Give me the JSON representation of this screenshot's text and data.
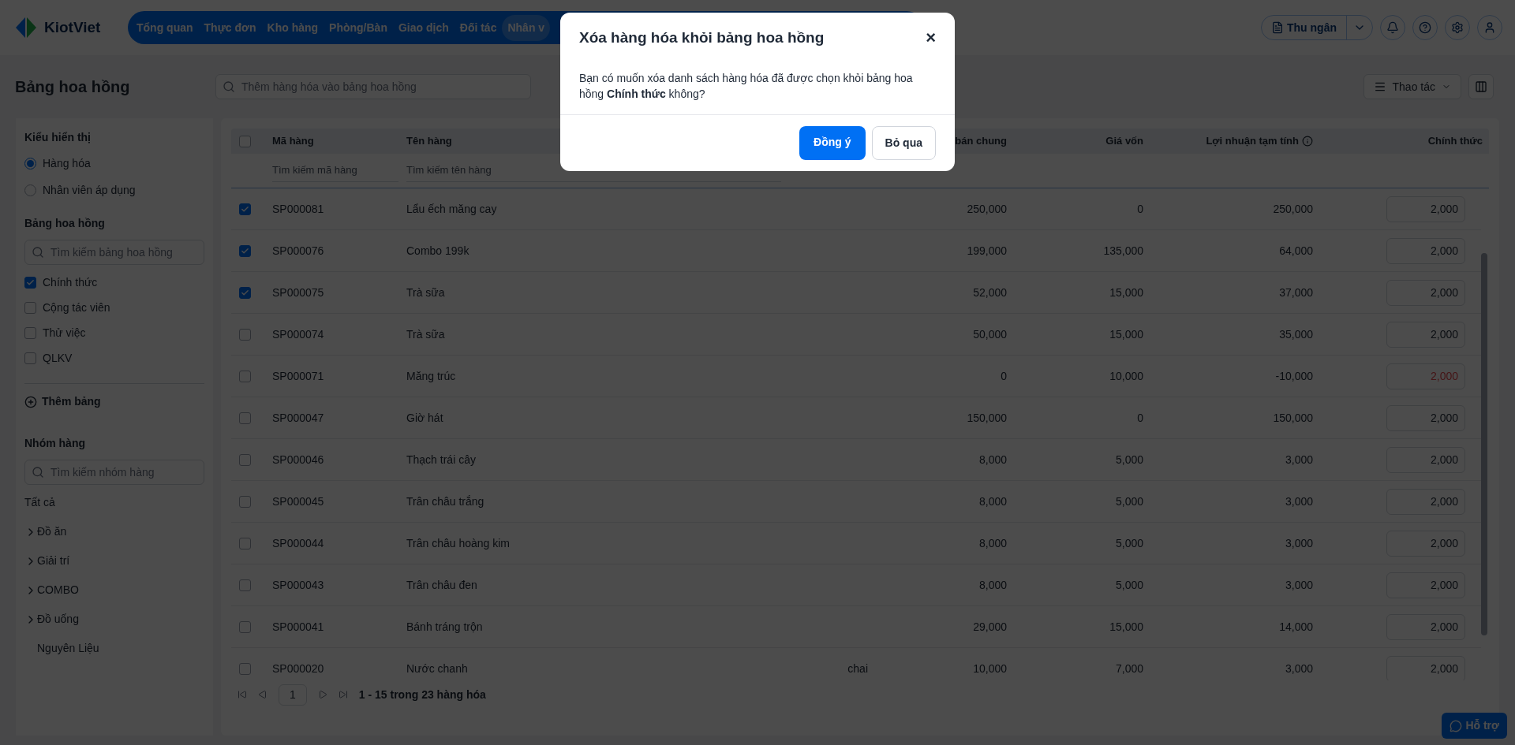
{
  "nav": {
    "logo": "KiotViet",
    "items": [
      {
        "label": "Tổng quan",
        "selected": false
      },
      {
        "label": "Thực đơn",
        "selected": false
      },
      {
        "label": "Kho hàng",
        "selected": false
      },
      {
        "label": "Phòng/Bàn",
        "selected": false
      },
      {
        "label": "Giao dịch",
        "selected": false
      },
      {
        "label": "Đối tác",
        "selected": false
      },
      {
        "label": "Nhân v",
        "selected": true
      }
    ],
    "cashier": "Thu ngân"
  },
  "page": {
    "title": "Bảng hoa hồng",
    "search_placeholder": "Thêm hàng hóa vào bảng hoa hồng",
    "actions": "Thao tác"
  },
  "sidebar": {
    "view_title": "Kiểu hiển thị",
    "views": [
      {
        "label": "Hàng hóa",
        "selected": true
      },
      {
        "label": "Nhân viên áp dụng",
        "selected": false
      }
    ],
    "tables_title": "Bảng hoa hồng",
    "tables_placeholder": "Tìm kiếm bảng hoa hồng",
    "tables": [
      {
        "label": "Chính thức",
        "checked": true
      },
      {
        "label": "Cộng tác viên",
        "checked": false
      },
      {
        "label": "Thử việc",
        "checked": false
      },
      {
        "label": "QLKV",
        "checked": false
      }
    ],
    "add_table": "Thêm bảng",
    "groups_title": "Nhóm hàng",
    "groups_placeholder": "Tìm kiếm nhóm hàng",
    "all": "Tất cả",
    "groups": [
      {
        "label": "Đồ ăn",
        "expandable": true
      },
      {
        "label": "Giải trí",
        "expandable": true
      },
      {
        "label": "COMBO",
        "expandable": true
      },
      {
        "label": "Đồ uống",
        "expandable": true
      },
      {
        "label": "Nguyên Liệu",
        "expandable": false
      }
    ]
  },
  "table": {
    "all_checked": false,
    "columns": [
      "Mã hàng",
      "Tên hàng",
      "bán chung",
      "Giá vốn",
      "Lợi nhuận tạm tính",
      "Chính thức"
    ],
    "filter_placeholders": [
      "Tìm kiếm mã hàng",
      "Tìm kiếm tên hàng"
    ],
    "rows": [
      {
        "code": "SP000081",
        "name": "Lẩu ếch măng cay",
        "price": "250,000",
        "cost": "0",
        "profit": "250,000",
        "commission": "2,000",
        "checked": true,
        "invalid": false
      },
      {
        "code": "SP000076",
        "name": "Combo 199k",
        "price": "199,000",
        "cost": "135,000",
        "profit": "64,000",
        "commission": "2,000",
        "checked": true,
        "invalid": false
      },
      {
        "code": "SP000075",
        "name": "Trà sữa",
        "price": "52,000",
        "cost": "15,000",
        "profit": "37,000",
        "commission": "2,000",
        "checked": true,
        "invalid": false
      },
      {
        "code": "SP000074",
        "name": "Trà sữa",
        "price": "50,000",
        "cost": "15,000",
        "profit": "35,000",
        "commission": "2,000",
        "checked": false,
        "invalid": false
      },
      {
        "code": "SP000071",
        "name": "Măng trúc",
        "price": "0",
        "cost": "10,000",
        "profit": "-10,000",
        "commission": "2,000",
        "checked": false,
        "invalid": true
      },
      {
        "code": "SP000047",
        "name": "Giờ hát",
        "price": "150,000",
        "cost": "0",
        "profit": "150,000",
        "commission": "2,000",
        "checked": false,
        "invalid": false
      },
      {
        "code": "SP000046",
        "name": "Thạch trái cây",
        "price": "8,000",
        "cost": "5,000",
        "profit": "3,000",
        "commission": "2,000",
        "checked": false,
        "invalid": false
      },
      {
        "code": "SP000045",
        "name": "Trân châu trắng",
        "price": "8,000",
        "cost": "5,000",
        "profit": "3,000",
        "commission": "2,000",
        "checked": false,
        "invalid": false
      },
      {
        "code": "SP000044",
        "name": "Trân châu hoàng kim",
        "price": "8,000",
        "cost": "5,000",
        "profit": "3,000",
        "commission": "2,000",
        "checked": false,
        "invalid": false
      },
      {
        "code": "SP000043",
        "name": "Trân châu đen",
        "price": "8,000",
        "cost": "5,000",
        "profit": "3,000",
        "commission": "2,000",
        "checked": false,
        "invalid": false
      },
      {
        "code": "SP000041",
        "name": "Bánh tráng trộn",
        "price": "29,000",
        "cost": "15,000",
        "profit": "14,000",
        "commission": "2,000",
        "checked": false,
        "invalid": false
      },
      {
        "code": "SP000020",
        "name": "Nước chanh",
        "unit": "chai",
        "price": "10,000",
        "cost": "7,000",
        "profit": "3,000",
        "commission": "2,000",
        "checked": false,
        "invalid": false
      }
    ],
    "page": "1",
    "summary": "1 - 15 trong 23 hàng hóa"
  },
  "dialog": {
    "title": "Xóa hàng hóa khỏi bảng hoa hồng",
    "close": "×",
    "message": "Bạn có muốn xóa danh sách hàng hóa đã được chọn khỏi bảng hoa hồng **Chính thức** không?",
    "confirm": "Đồng ý",
    "cancel": "Bỏ qua"
  },
  "support": "Hỗ trợ"
}
